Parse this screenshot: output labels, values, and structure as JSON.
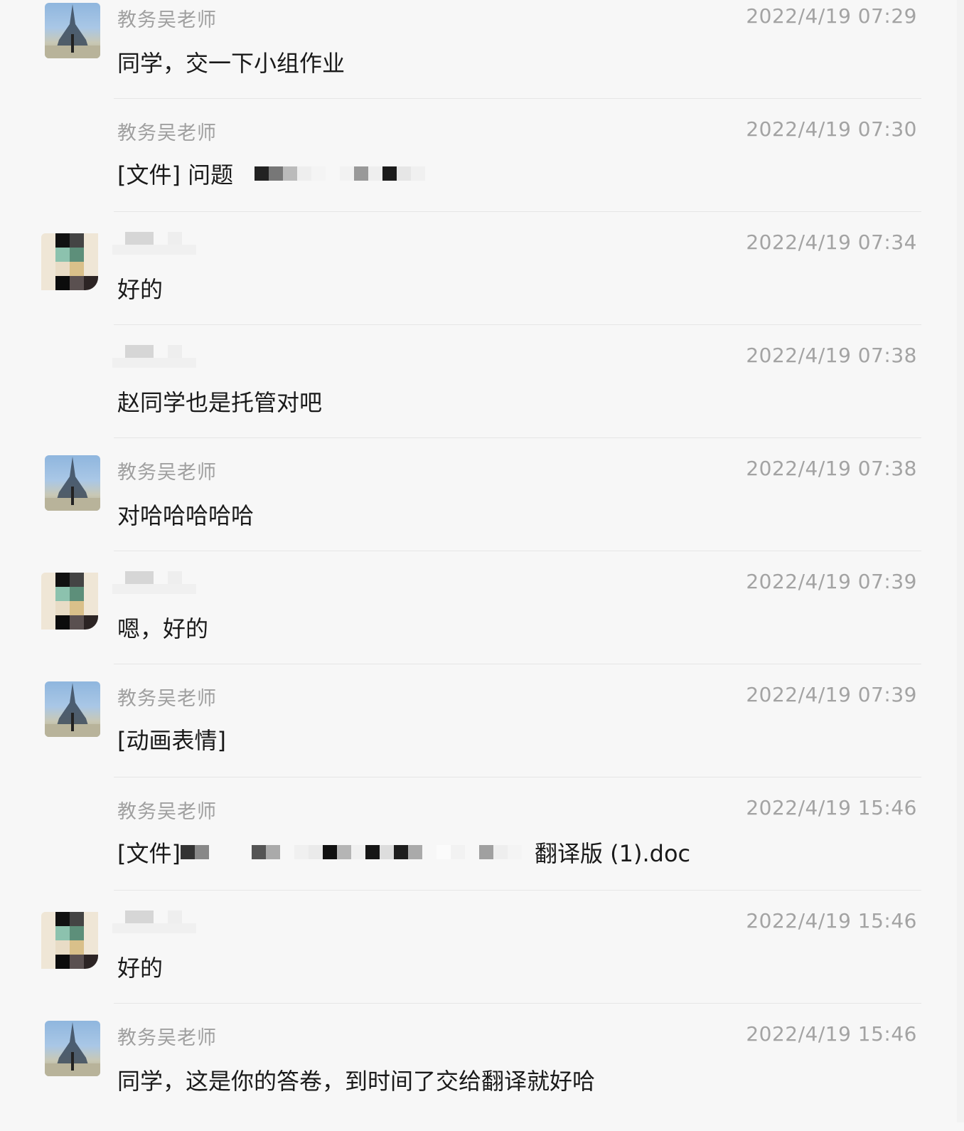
{
  "chat": {
    "messages": [
      {
        "sender": "教务吴老师",
        "time": "2022/4/19 07:29",
        "text": "同学，交一下小组作业",
        "avatar": "eiffel-tower-photo"
      },
      {
        "sender": "教务吴老师",
        "time": "2022/4/19 07:30",
        "text_prefix": "[文件] 问题",
        "avatar": null
      },
      {
        "sender": "",
        "time": "2022/4/19 07:34",
        "text": "好的",
        "avatar": "mosaic-redacted"
      },
      {
        "sender": "",
        "time": "2022/4/19 07:38",
        "text": "赵同学也是托管对吧",
        "avatar": null
      },
      {
        "sender": "教务吴老师",
        "time": "2022/4/19 07:38",
        "text": "对哈哈哈哈哈",
        "avatar": "eiffel-tower-photo"
      },
      {
        "sender": "",
        "time": "2022/4/19 07:39",
        "text": "嗯，好的",
        "avatar": "mosaic-redacted"
      },
      {
        "sender": "教务吴老师",
        "time": "2022/4/19 07:39",
        "text": "[动画表情]",
        "avatar": "eiffel-tower-photo"
      },
      {
        "sender": "教务吴老师",
        "time": "2022/4/19 15:46",
        "text_prefix": "[文件]",
        "text_suffix": "翻译版 (1).doc",
        "avatar": null
      },
      {
        "sender": "",
        "time": "2022/4/19 15:46",
        "text": "好的",
        "avatar": "mosaic-redacted"
      },
      {
        "sender": "教务吴老师",
        "time": "2022/4/19 15:46",
        "text": "同学，这是你的答卷，到时间了交给翻译就好哈",
        "avatar": "eiffel-tower-photo"
      }
    ]
  },
  "colors": {
    "background": "#f7f7f7",
    "sender": "#a0a0a0",
    "text": "#1a1a1a",
    "divider": "#e6e6e6"
  }
}
